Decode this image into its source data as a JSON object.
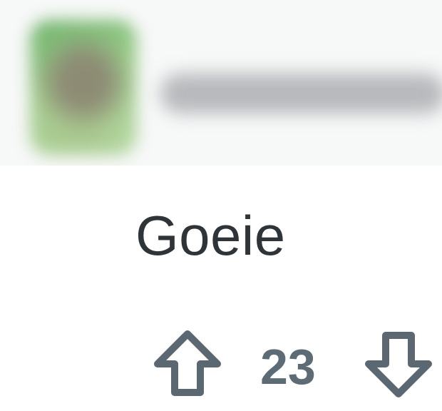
{
  "comment": {
    "text": "Goeie"
  },
  "votes": {
    "score": "23",
    "up_icon": "arrow-up-icon",
    "down_icon": "arrow-down-icon"
  },
  "colors": {
    "text": "#2f3438",
    "score": "#5d6b74",
    "icon": "#5b6871",
    "background": "#ffffff"
  }
}
